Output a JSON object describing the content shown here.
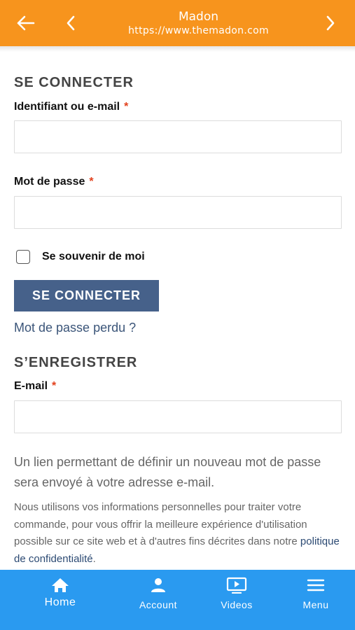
{
  "browser": {
    "title": "Madon",
    "url": "https://www.themadon.com"
  },
  "login": {
    "heading": "SE CONNECTER",
    "username_label": "Identifiant ou e-mail",
    "required_mark": "*",
    "username_value": "",
    "password_label": "Mot de passe",
    "password_value": "",
    "remember_label": "Se souvenir de moi",
    "remember_checked": false,
    "submit_label": "SE CONNECTER",
    "lost_password": "Mot de passe perdu ?"
  },
  "register": {
    "heading": "S’ENREGISTRER",
    "email_label": "E-mail",
    "email_value": "",
    "info": "Un lien permettant de définir un nouveau mot de passe sera envoyé à votre adresse e-mail.",
    "privacy_prefix": "Nous utilisons vos informations personnelles pour traiter votre commande, pour vous offrir la meilleure expérience d'utilisation possible sur ce site web et à d'autres fins décrites dans notre ",
    "privacy_link": "politique de confidentialité",
    "privacy_suffix": "."
  },
  "bottom_nav": {
    "items": [
      {
        "label": "Home",
        "icon": "home-icon"
      },
      {
        "label": "Account",
        "icon": "account-icon"
      },
      {
        "label": "Videos",
        "icon": "videos-icon"
      },
      {
        "label": "Menu",
        "icon": "menu-icon"
      }
    ]
  },
  "colors": {
    "top_bar": "#f7941d",
    "bottom_nav": "#2a9af0",
    "primary_button": "#46618a",
    "required": "#e2401c",
    "link": "#2c4a73"
  }
}
